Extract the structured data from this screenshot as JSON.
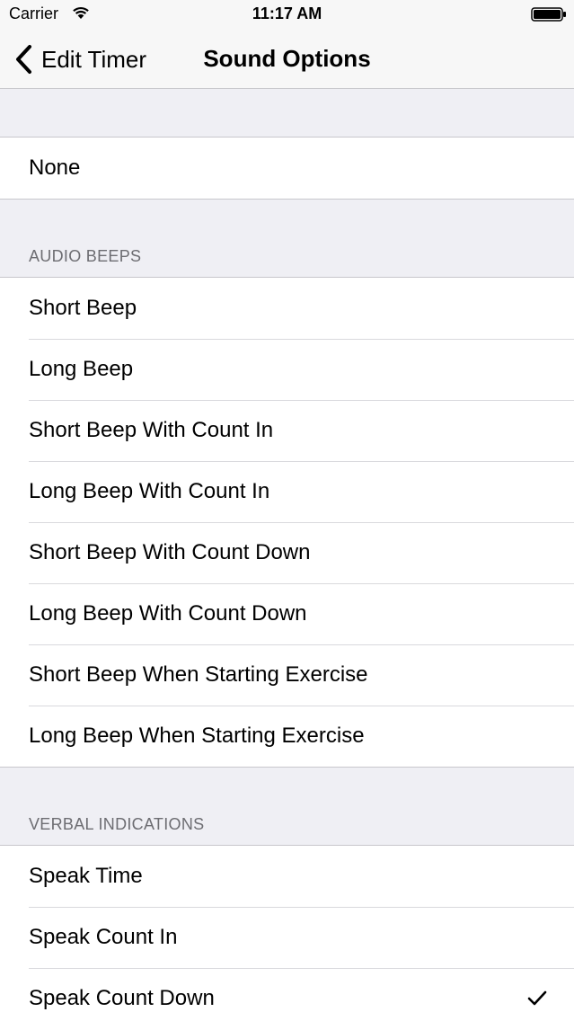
{
  "status_bar": {
    "carrier": "Carrier",
    "time": "11:17 AM",
    "wifi_icon": "wifi-icon",
    "battery_icon": "battery-icon"
  },
  "nav": {
    "back_label": "Edit Timer",
    "back_icon": "chevron-left-icon",
    "title": "Sound Options"
  },
  "sections": [
    {
      "header": "",
      "items": [
        {
          "label": "None",
          "selected": false
        }
      ]
    },
    {
      "header": "AUDIO BEEPS",
      "items": [
        {
          "label": "Short Beep",
          "selected": false
        },
        {
          "label": "Long Beep",
          "selected": false
        },
        {
          "label": "Short Beep With Count In",
          "selected": false
        },
        {
          "label": "Long Beep With Count In",
          "selected": false
        },
        {
          "label": "Short Beep With Count Down",
          "selected": false
        },
        {
          "label": "Long Beep With Count Down",
          "selected": false
        },
        {
          "label": "Short Beep When Starting Exercise",
          "selected": false
        },
        {
          "label": "Long Beep When Starting Exercise",
          "selected": false
        }
      ]
    },
    {
      "header": "VERBAL INDICATIONS",
      "items": [
        {
          "label": "Speak Time",
          "selected": false
        },
        {
          "label": "Speak Count In",
          "selected": false
        },
        {
          "label": "Speak Count Down",
          "selected": true
        }
      ]
    }
  ],
  "colors": {
    "background": "#efeff4",
    "separator": "#c8c7cc",
    "header_text": "#6d6d72",
    "checkmark": "#000000"
  }
}
